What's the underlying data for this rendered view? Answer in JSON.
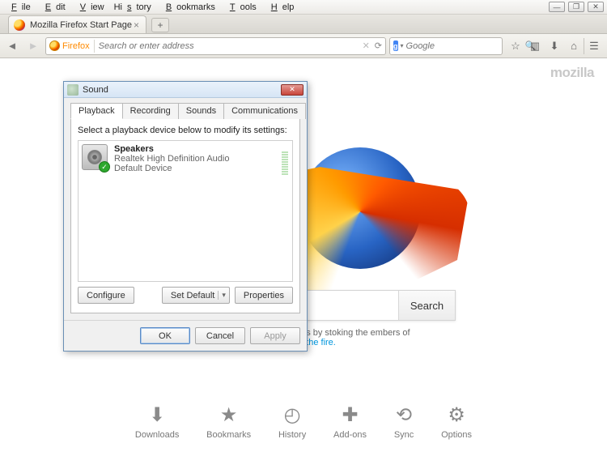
{
  "menubar": {
    "file": "File",
    "edit": "Edit",
    "view": "View",
    "history": "History",
    "bookmarks": "Bookmarks",
    "tools": "Tools",
    "help": "Help"
  },
  "tab": {
    "title": "Mozilla Firefox Start Page"
  },
  "newtab_tooltip": "+",
  "urlbar": {
    "chip": "Firefox",
    "placeholder": "Search or enter address"
  },
  "searchbar": {
    "engine": "g",
    "placeholder": "Google"
  },
  "brand": "mozilla",
  "mainsearch": {
    "button": "Search"
  },
  "anniv": {
    "text": "We're celebrating 10 years by stoking the embers of ",
    "link": "to fuel the fire."
  },
  "quicklinks": {
    "downloads": "Downloads",
    "bookmarks": "Bookmarks",
    "history": "History",
    "addons": "Add-ons",
    "sync": "Sync",
    "options": "Options"
  },
  "dialog": {
    "title": "Sound",
    "tabs": {
      "playback": "Playback",
      "recording": "Recording",
      "sounds": "Sounds",
      "comm": "Communications"
    },
    "instruction": "Select a playback device below to modify its settings:",
    "device": {
      "name": "Speakers",
      "driver": "Realtek High Definition Audio",
      "status": "Default Device"
    },
    "buttons": {
      "configure": "Configure",
      "setdefault": "Set Default",
      "properties": "Properties",
      "ok": "OK",
      "cancel": "Cancel",
      "apply": "Apply"
    }
  }
}
